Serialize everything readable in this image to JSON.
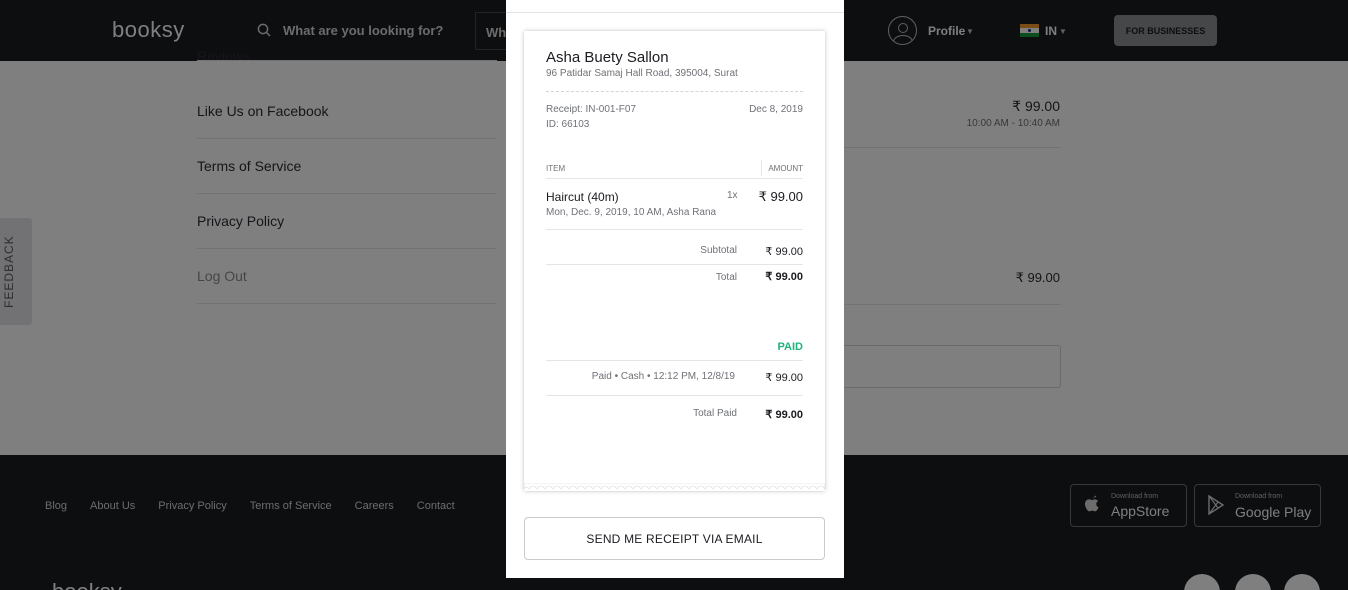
{
  "header": {
    "logo": "booksy",
    "search_placeholder": "What are you looking for?",
    "where_placeholder": "Wh",
    "profile_label": "Profile",
    "country_code": "IN",
    "for_businesses": "FOR BUSINESSES"
  },
  "menu": {
    "partial_item": "Reviews",
    "items": [
      "Like Us on Facebook",
      "Terms of Service",
      "Privacy Policy"
    ],
    "logout": "Log Out"
  },
  "appointments": {
    "first_price": "₹ 99.00",
    "first_time": "10:00 AM - 10:40 AM",
    "second_price": "₹ 99.00"
  },
  "feedback_tab": "FEEDBACK",
  "footer": {
    "links": [
      "Blog",
      "About Us",
      "Privacy Policy",
      "Terms of Service",
      "Careers",
      "Contact"
    ],
    "appstore_small": "Download from",
    "appstore_big": "AppStore",
    "googleplay_small": "Download from",
    "googleplay_big": "Google Play",
    "logo": "booksy"
  },
  "receipt": {
    "salon_name": "Asha Buety Sallon",
    "salon_address": "96 Patidar Samaj Hall Road, 395004, Surat",
    "receipt_number": "Receipt: IN-001-F07",
    "receipt_id": "ID: 66103",
    "date": "Dec 8, 2019",
    "col_item": "ITEM",
    "col_amount": "AMOUNT",
    "service_name": "Haircut (40m)",
    "service_detail": "Mon, Dec. 9, 2019, 10 AM, Asha Rana",
    "service_qty": "1x",
    "service_price": "₹ 99.00",
    "subtotal_label": "Subtotal",
    "subtotal_value": "₹ 99.00",
    "total_label": "Total",
    "total_value": "₹ 99.00",
    "paid_status": "PAID",
    "payment_line": "Paid • Cash • 12:12 PM, 12/8/19",
    "payment_value": "₹ 99.00",
    "total_paid_label": "Total Paid",
    "total_paid_value": "₹ 99.00"
  },
  "email_button": "SEND ME RECEIPT VIA EMAIL",
  "colors": {
    "header_bg": "#1b1c21",
    "paid_green": "#1fb37a",
    "overlay": "rgba(0,0,0,0.5)"
  }
}
